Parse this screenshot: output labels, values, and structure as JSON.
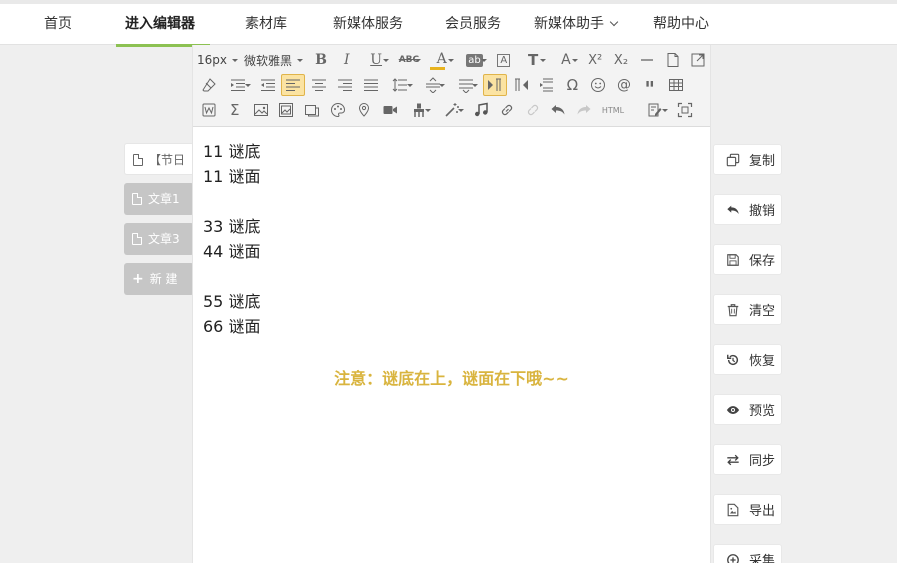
{
  "nav": {
    "items": [
      "首页",
      "进入编辑器",
      "素材库",
      "新媒体服务",
      "会员服务",
      "新媒体助手",
      "帮助中心"
    ],
    "active_index": 1
  },
  "articles": {
    "tabs": [
      "【节日",
      "文章1",
      "文章3"
    ],
    "new_label": "新 建"
  },
  "toolbar": {
    "font_size": "16px",
    "font_family": "微软雅黑",
    "html_label": "HTML",
    "accent_color": "#e8b31f"
  },
  "content": {
    "lines": [
      "11 谜底",
      "11 谜面",
      "",
      "33 谜底",
      "44 谜面",
      "",
      "55 谜底",
      "66 谜面"
    ],
    "note": "注意：谜底在上，谜面在下哦~~",
    "note_color": "#d9b43e"
  },
  "side": {
    "buttons": [
      "复制",
      "撤销",
      "保存",
      "清空",
      "恢复",
      "预览",
      "同步",
      "导出",
      "采集"
    ],
    "icons": [
      "copy-icon",
      "undo-icon",
      "save-icon",
      "trash-icon",
      "restore-icon",
      "eye-icon",
      "sync-icon",
      "export-icon",
      "collect-icon"
    ]
  }
}
